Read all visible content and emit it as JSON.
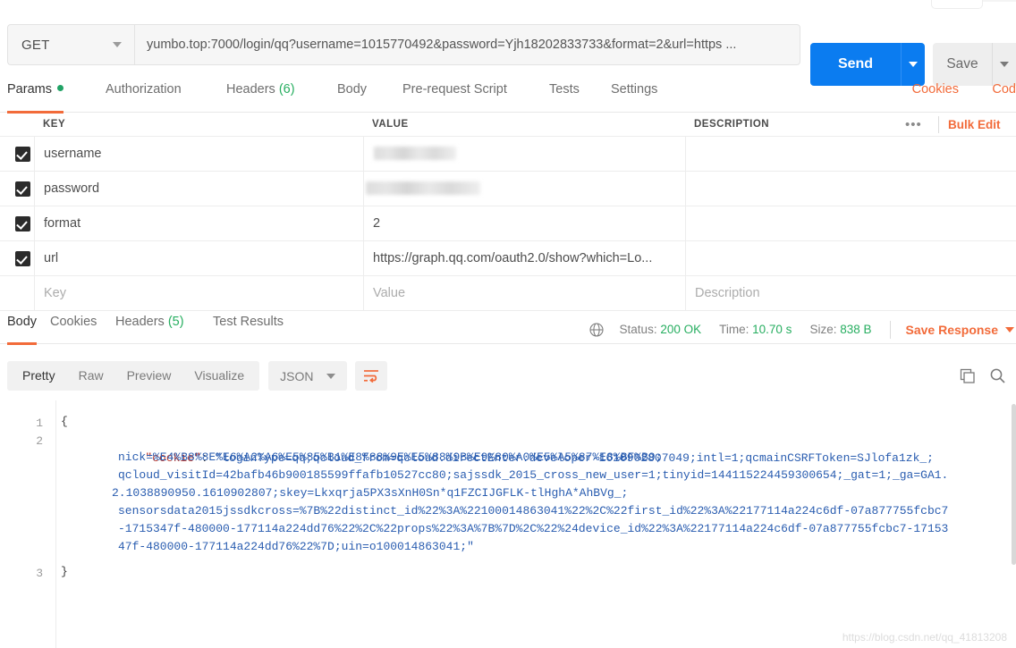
{
  "request": {
    "method": "GET",
    "url": "yumbo.top:7000/login/qq?username=1015770492&password=Yjh18202833733&format=2&url=https ...",
    "send_label": "Send",
    "save_label": "Save"
  },
  "request_tabs": [
    {
      "label": "Params",
      "dot": true,
      "active": true,
      "count": ""
    },
    {
      "label": "Authorization",
      "dot": false,
      "active": false,
      "count": ""
    },
    {
      "label": "Headers",
      "dot": false,
      "active": false,
      "count": "(6)"
    },
    {
      "label": "Body",
      "dot": false,
      "active": false,
      "count": ""
    },
    {
      "label": "Pre-request Script",
      "dot": false,
      "active": false,
      "count": ""
    },
    {
      "label": "Tests",
      "dot": false,
      "active": false,
      "count": ""
    },
    {
      "label": "Settings",
      "dot": false,
      "active": false,
      "count": ""
    }
  ],
  "request_tab_links": [
    {
      "label": "Cookies"
    },
    {
      "label": "Cod"
    }
  ],
  "params": {
    "headers": {
      "key": "KEY",
      "value": "VALUE",
      "description": "DESCRIPTION"
    },
    "dots": "•••",
    "bulk_edit": "Bulk Edit",
    "rows": [
      {
        "checked": true,
        "key": "username",
        "value": "",
        "redacted": true,
        "description": ""
      },
      {
        "checked": true,
        "key": "password",
        "value": "",
        "redacted": true,
        "description": ""
      },
      {
        "checked": true,
        "key": "format",
        "value": "2",
        "redacted": false,
        "description": ""
      },
      {
        "checked": true,
        "key": "url",
        "value": "https://graph.qq.com/oauth2.0/show?which=Lo...",
        "redacted": false,
        "description": ""
      }
    ],
    "placeholder_row": {
      "key": "Key",
      "value": "Value",
      "description": "Description"
    }
  },
  "response_tabs": [
    {
      "label": "Body",
      "active": true,
      "count": ""
    },
    {
      "label": "Cookies",
      "active": false,
      "count": ""
    },
    {
      "label": "Headers",
      "active": false,
      "count": "(5)"
    },
    {
      "label": "Test Results",
      "active": false,
      "count": ""
    }
  ],
  "response_status": {
    "status_label": "Status:",
    "status_value": "200 OK",
    "time_label": "Time:",
    "time_value": "10.70 s",
    "size_label": "Size:",
    "size_value": "838 B",
    "save_response": "Save Response"
  },
  "view_toolbar": {
    "modes": [
      {
        "label": "Pretty",
        "active": true
      },
      {
        "label": "Raw",
        "active": false
      },
      {
        "label": "Preview",
        "active": false
      },
      {
        "label": "Visualize",
        "active": false
      }
    ],
    "type": "JSON"
  },
  "body": {
    "line_numbers": [
      "1",
      "2",
      "3"
    ],
    "open_brace": "{",
    "close_brace": "}",
    "key": "\"cookie\"",
    "colon": ": ",
    "value_line1": "\"loginType=qq;qcloud_from=qcloud.directEnter.developer-1610902807049;intl=1;qcmainCSRFToken=SJlofa1zk_;",
    "value_line2": "nick=%E4%B8%8E%E6%A2%A6%E5%85%B1%E8%88%9E%E5%88%9B%E9%80%A0%E5%A5%87%E8%BF%B9;",
    "value_line3": "qcloud_visitId=42bafb46b900185599ffafb10527cc80;sajssdk_2015_cross_new_user=1;tinyid=144115224459300654;_gat=1;_ga=GA1.",
    "value_line4": "2.1038890950.1610902807;skey=Lkxqrja5PX3sXnH0Sn*q1FZCIJGFLK-tlHghA*AhBVg_;",
    "value_line5": "sensorsdata2015jssdkcross=%7B%22distinct_id%22%3A%22100014863041%22%2C%22first_id%22%3A%22177114a224c6df-07a877755fcbc7",
    "value_line6": "-1715347f-480000-177114a224dd76%22%2C%22props%22%3A%7B%7D%2C%22%24device_id%22%3A%22177114a224c6df-07a877755fcbc7-17153",
    "value_line7": "47f-480000-177114a224dd76%22%7D;uin=o100014863041;\""
  },
  "watermark": "https://blog.csdn.net/qq_41813208",
  "colors": {
    "accent_orange": "#f26b3a",
    "send_blue": "#0b7cf0",
    "status_green": "#27ae60",
    "code_blue": "#2a5db0",
    "code_red": "#c0392b"
  }
}
